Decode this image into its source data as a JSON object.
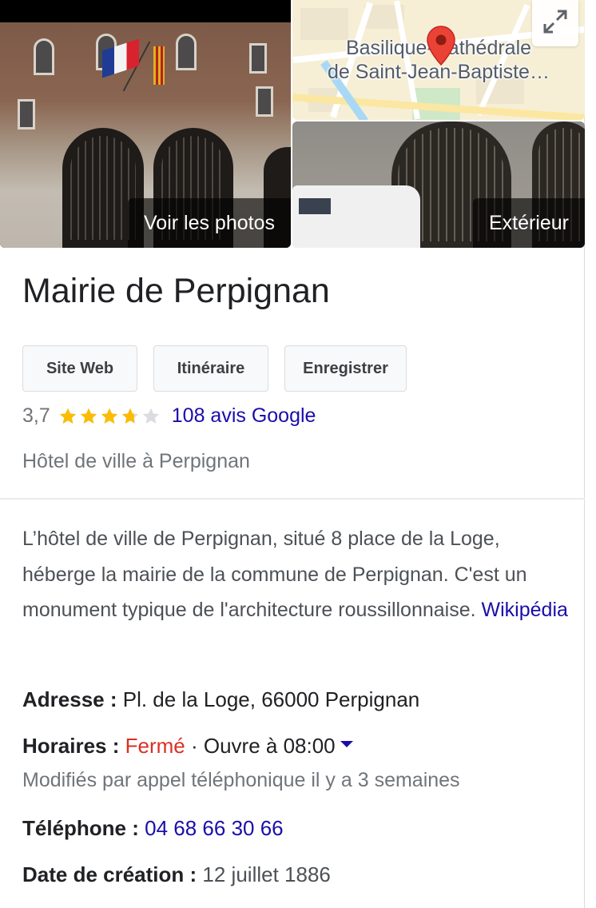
{
  "photos": {
    "main_label": "Voir les photos",
    "map_label_line1": "Basilique-Cathédrale",
    "map_label_line2": "de Saint-Jean-Baptiste…",
    "exterior_label": "Extérieur"
  },
  "title": "Mairie de Perpignan",
  "buttons": {
    "website": "Site Web",
    "directions": "Itinéraire",
    "save": "Enregistrer"
  },
  "rating": {
    "value": "3,7",
    "stars_filled": 3.7,
    "star_color": "#fbbc04",
    "star_empty_color": "#dadce0",
    "reviews_link": "108 avis Google"
  },
  "category": "Hôtel de ville à Perpignan",
  "description": {
    "text": "L’hôtel de ville de Perpignan, situé 8 place de la Loge, héberge la mairie de la commune de Perpignan. C'est un monument typique de l'architecture roussillonnaise.",
    "source_link": "Wikipédia"
  },
  "facts": {
    "address_label": "Adresse :",
    "address_value": "Pl. de la Loge, 66000 Perpignan",
    "hours_label": "Horaires :",
    "hours_status": "Fermé",
    "hours_separator": " · ",
    "hours_next": "Ouvre à 08:00",
    "hours_note": "Modifiés par appel téléphonique il y a 3 semaines",
    "phone_label": "Téléphone :",
    "phone_value": "04 68 66 30 66",
    "founded_label": "Date de création :",
    "founded_value": "12 juillet 1886"
  },
  "colors": {
    "link": "#1a0dab",
    "closed": "#d93025",
    "secondary_text": "#70757a",
    "map_pin": "#ea4335"
  },
  "icons": {
    "expand": "expand-icon",
    "pin": "map-pin-icon",
    "hours_dropdown": "caret-down-icon"
  }
}
